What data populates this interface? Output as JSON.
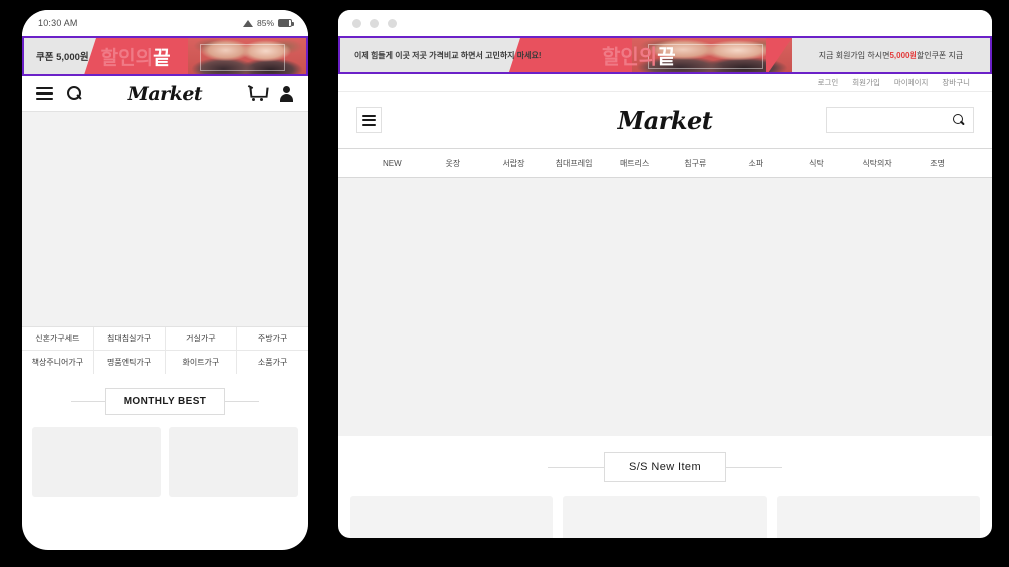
{
  "mobile": {
    "status": {
      "time": "10:30 AM",
      "battery": "85%",
      "wifi_icon": "wifi-icon",
      "battery_icon": "battery-icon"
    },
    "promo": {
      "coupon_text": "쿠폰 5,000원",
      "headline_light": "할인의",
      "headline_bold": "끝"
    },
    "header": {
      "menu_icon": "hamburger-icon",
      "search_icon": "search-icon",
      "logo": "Market",
      "cart_icon": "cart-icon",
      "account_icon": "user-icon"
    },
    "categories": [
      [
        "신혼가구세트",
        "침대침실가구",
        "거실가구",
        "주방가구"
      ],
      [
        "책상주니어가구",
        "명품엔틱가구",
        "화이트가구",
        "소품가구"
      ]
    ],
    "section_title": "MONTHLY BEST"
  },
  "desktop": {
    "window_dots": [
      "close-dot",
      "minimize-dot",
      "maximize-dot"
    ],
    "promo": {
      "message": "이제 힘들게 이곳 저곳 가격비교 하면서 고민하지 마세요!",
      "headline_light": "할인의",
      "headline_bold": "끝",
      "signup_prefix": "지금 회원가입 하시면 ",
      "signup_highlight": "5,000원",
      "signup_suffix": " 할인쿠폰 지급"
    },
    "utility_links": [
      "로그인",
      "회원가입",
      "마이페이지",
      "장바구니"
    ],
    "header": {
      "menu_icon": "hamburger-icon",
      "logo": "Market",
      "search_value": "",
      "search_placeholder": "",
      "search_icon": "search-icon"
    },
    "nav": [
      "NEW",
      "옷장",
      "서랍장",
      "침대프레임",
      "매트리스",
      "침구류",
      "소파",
      "식탁",
      "식탁의자",
      "조명"
    ],
    "section_title": "S/S New Item"
  },
  "colors": {
    "banner_border": "#6b21c8",
    "banner_red": "#e8515e",
    "banner_bg": "#e6e6e6",
    "highlight_red": "#e23b3b",
    "page_bg": "#000000",
    "content_gray": "#f2f2f2"
  }
}
